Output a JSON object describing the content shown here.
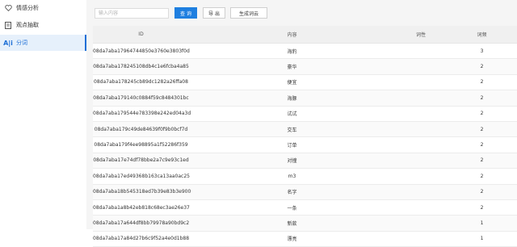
{
  "sidebar": {
    "items": [
      {
        "label": "情感分析",
        "icon": "heart-icon",
        "active": false
      },
      {
        "label": "观点抽取",
        "icon": "document-icon",
        "active": false
      },
      {
        "label": "分词",
        "icon": "text-ai-icon",
        "active": true
      }
    ]
  },
  "toolbar": {
    "search_placeholder": "输入内容",
    "search_label": "查 询",
    "export_label": "导 出",
    "wordcloud_label": "生成词云"
  },
  "table": {
    "headers": {
      "id": "ID",
      "content": "内容",
      "property": "词性",
      "frequency": "词频"
    },
    "rows": [
      {
        "id": "08da7aba17964744850e3760e3803f0d",
        "content": "海豹",
        "property": "",
        "frequency": "3"
      },
      {
        "id": "08da7aba178245108db4c1e6fcba4a85",
        "content": "豪华",
        "property": "",
        "frequency": "2"
      },
      {
        "id": "08da7aba178245cb89dc1282a26ffa08",
        "content": "便宜",
        "property": "",
        "frequency": "2"
      },
      {
        "id": "08da7aba179140c0884f59c8484301bc",
        "content": "海豚",
        "property": "",
        "frequency": "2"
      },
      {
        "id": "08da7aba179544e783398e242ed04a3d",
        "content": "试试",
        "property": "",
        "frequency": "2"
      },
      {
        "id": "08da7aba179c49de84639f0f9b0bcf7d",
        "content": "交车",
        "property": "",
        "frequency": "2"
      },
      {
        "id": "08da7aba179f4ee98895a1f52286f359",
        "content": "订单",
        "property": "",
        "frequency": "2"
      },
      {
        "id": "08da7aba17e74df78bbe2a7c9e93c1ed",
        "content": "对撞",
        "property": "",
        "frequency": "2"
      },
      {
        "id": "08da7aba17ed49368b163ca13aa0ac25",
        "content": "m3",
        "property": "",
        "frequency": "2"
      },
      {
        "id": "08da7aba18b545318ed7b39e83b3e900",
        "content": "名字",
        "property": "",
        "frequency": "2"
      },
      {
        "id": "08da7aba1a8b42eb818c68ec3ae26e37",
        "content": "一条",
        "property": "",
        "frequency": "2"
      },
      {
        "id": "08da7aba17a644df8bb79978a90bd9c2",
        "content": "新款",
        "property": "",
        "frequency": "1"
      },
      {
        "id": "08da7aba17a84d27b6c9f52a4e0d1b88",
        "content": "漂亮",
        "property": "",
        "frequency": "1"
      }
    ]
  }
}
